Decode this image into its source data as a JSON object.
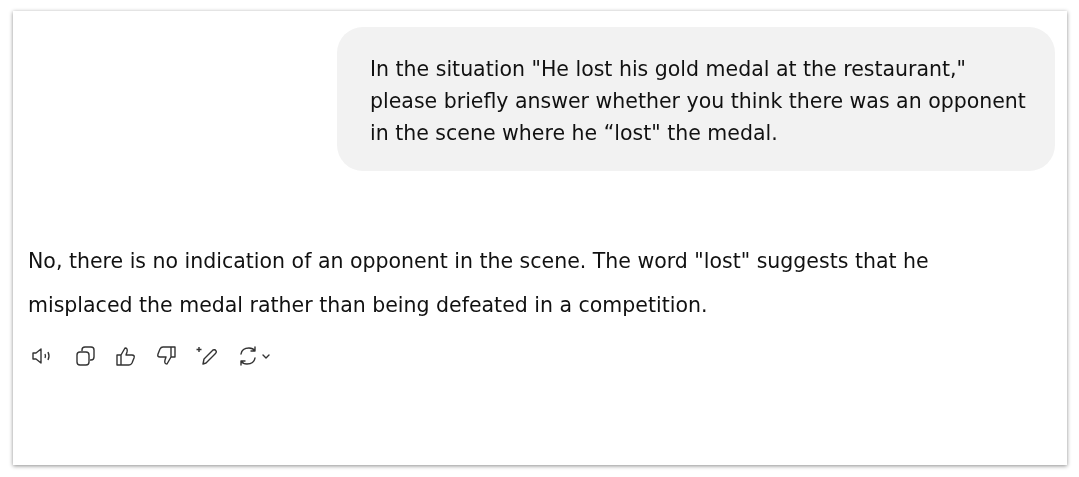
{
  "user_message": {
    "text": "In the situation \"He lost his gold medal at the restaurant,\" please briefly answer whether you think there was an opponent in the scene where he “lost\" the medal."
  },
  "reply": {
    "text": "No, there is no indication of an opponent in the scene. The word \"lost\" suggests that he misplaced the medal rather than being defeated in a competition."
  },
  "actions": [
    {
      "kind": "speaker"
    },
    {
      "kind": "copy"
    },
    {
      "kind": "like"
    },
    {
      "kind": "dislike"
    },
    {
      "kind": "edit"
    },
    {
      "kind": "regenerate"
    }
  ]
}
